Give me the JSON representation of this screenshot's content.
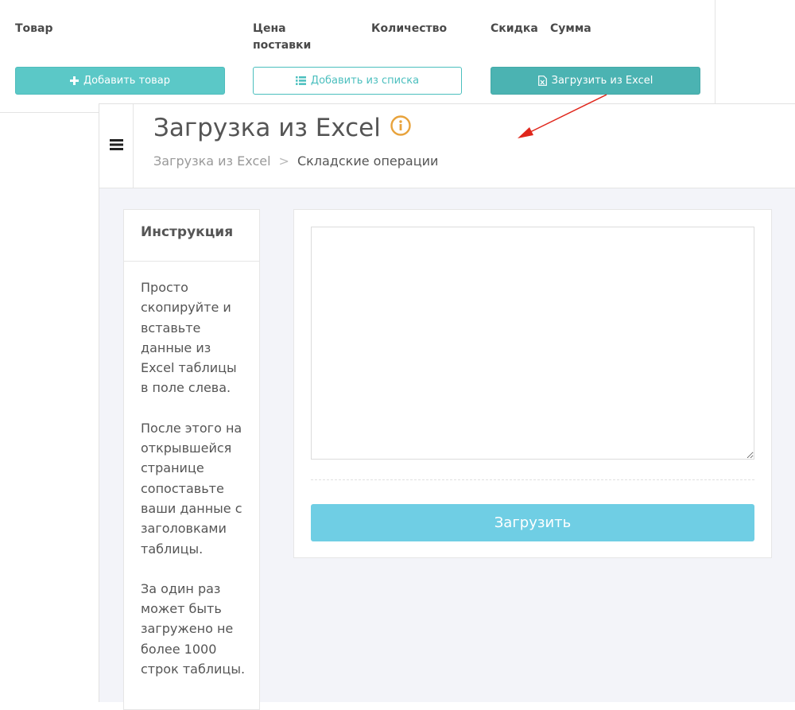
{
  "table_header": {
    "columns": [
      "Товар",
      "Цена поставки",
      "Количество",
      "Скидка",
      "Сумма"
    ]
  },
  "toolbar": {
    "add_product": "Добавить товар",
    "add_from_list": "Добавить из списка",
    "import_excel": "Загрузить из Excel"
  },
  "header": {
    "title": "Загрузка из Excel",
    "breadcrumb": {
      "parent": "Загрузка из Excel",
      "separator": ">",
      "current": "Складские операции"
    }
  },
  "instruction": {
    "title": "Инструкция",
    "paragraphs": [
      "Просто скопируйте и вставьте данные из Excel таблицы в поле слева.",
      "После этого на открывшейся странице сопоставьте ваши данные с заголовками таблицы.",
      "За один раз может быть загружено не более 1000 строк таблицы."
    ]
  },
  "form": {
    "paste_value": "",
    "upload_label": "Загрузить"
  },
  "colors": {
    "teal": "#5bc8c7",
    "teal_dark": "#4bb3b2",
    "upload_blue": "#6fcee4",
    "info_orange": "#e8a33c",
    "arrow_red": "#e0261b"
  },
  "icons": {
    "add": "plus-icon",
    "list": "list-icon",
    "excel": "excel-file-icon",
    "info": "info-icon",
    "menu": "hamburger-menu-icon"
  }
}
